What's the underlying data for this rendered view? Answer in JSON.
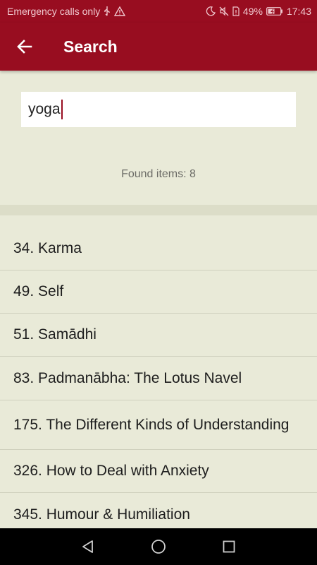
{
  "status_bar": {
    "carrier_text": "Emergency calls only",
    "battery": "49%",
    "time": "17:43"
  },
  "app_bar": {
    "title": "Search",
    "back_icon": "arrow-left-icon"
  },
  "search": {
    "value": "yoga",
    "found_label": "Found items: 8"
  },
  "results": [
    {
      "label": "34. Karma"
    },
    {
      "label": "49. Self"
    },
    {
      "label": "51. Samādhi"
    },
    {
      "label": "83. Padmanābha: The Lotus Navel"
    },
    {
      "label": "175. The Different Kinds of Understanding"
    },
    {
      "label": "326. How to Deal with Anxiety"
    },
    {
      "label": "345. Humour & Humiliation"
    }
  ],
  "colors": {
    "primary": "#980d20",
    "background": "#e9ead8",
    "divider": "#cfd0bd"
  },
  "nav_bar": {
    "icons": [
      "back-triangle-icon",
      "home-circle-icon",
      "recents-square-icon"
    ]
  }
}
